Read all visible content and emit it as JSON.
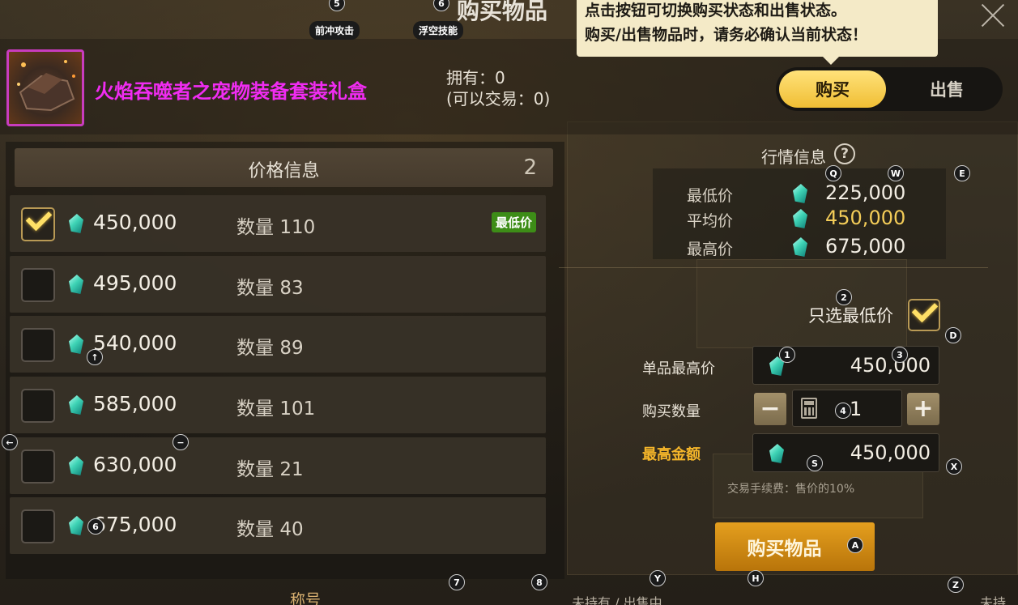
{
  "window": {
    "title": "购买物品",
    "tooltip_line1": "点击按钮可切换购买状态和出售状态。",
    "tooltip_line2": "购买/出售物品时，请务必确认当前状态！"
  },
  "skills": [
    {
      "key": "5",
      "label": "前冲攻击"
    },
    {
      "key": "6",
      "label": "浮空技能"
    }
  ],
  "item": {
    "name": "火焰吞噬者之宠物装备套装礼盒",
    "owned": "拥有：0",
    "tradable": "(可以交易：0)"
  },
  "mode_toggle": {
    "buy": "购买",
    "sell": "出售",
    "active": "buy"
  },
  "price_info": {
    "header": "价格信息",
    "count": "2",
    "rows": [
      {
        "price": "450,000",
        "qty_label": "数量",
        "qty": "110",
        "checked": true,
        "badge": "最低价"
      },
      {
        "price": "495,000",
        "qty_label": "数量",
        "qty": "83",
        "checked": false,
        "badge": ""
      },
      {
        "price": "540,000",
        "qty_label": "数量",
        "qty": "89",
        "checked": false,
        "badge": ""
      },
      {
        "price": "585,000",
        "qty_label": "数量",
        "qty": "101",
        "checked": false,
        "badge": ""
      },
      {
        "price": "630,000",
        "qty_label": "数量",
        "qty": "21",
        "checked": false,
        "badge": ""
      },
      {
        "price": "675,000",
        "qty_label": "数量",
        "qty": "40",
        "checked": false,
        "badge": ""
      }
    ]
  },
  "market": {
    "title": "行情信息",
    "help": "?",
    "min_label": "最低价",
    "min_value": "225,000",
    "avg_label": "平均价",
    "avg_value": "450,000",
    "max_label": "最高价",
    "max_value": "675,000"
  },
  "form": {
    "only_lowest_label": "只选最低价",
    "only_lowest_checked": true,
    "unit_max_label": "单品最高价",
    "unit_max_value": "450,000",
    "quantity_label": "购买数量",
    "quantity_value": "1",
    "minus": "−",
    "plus": "+",
    "total_label": "最高金额",
    "total_value": "450,000",
    "fee_note": "交易手续费：售价的10%",
    "buy_button": "购买物品"
  },
  "hotkeys": {
    "q": "Q",
    "w": "W",
    "e": "E",
    "d": "D",
    "s": "S",
    "x": "X",
    "a": "A",
    "h": "H",
    "y": "Y",
    "z": "Z",
    "n1": "1",
    "n2": "2",
    "n3": "3",
    "n4": "4",
    "n6": "6",
    "n7": "7",
    "n8": "8",
    "up": "↑",
    "left": "←",
    "minus": "−"
  },
  "background": {
    "title_tab": "称号",
    "status1": "未持有 / 出售中",
    "status2": "未持有"
  },
  "colors": {
    "accent_gold": "#f0be34",
    "item_name": "#f02cf2",
    "badge_green": "#3d8d17",
    "avg_price": "#f3cc58"
  }
}
